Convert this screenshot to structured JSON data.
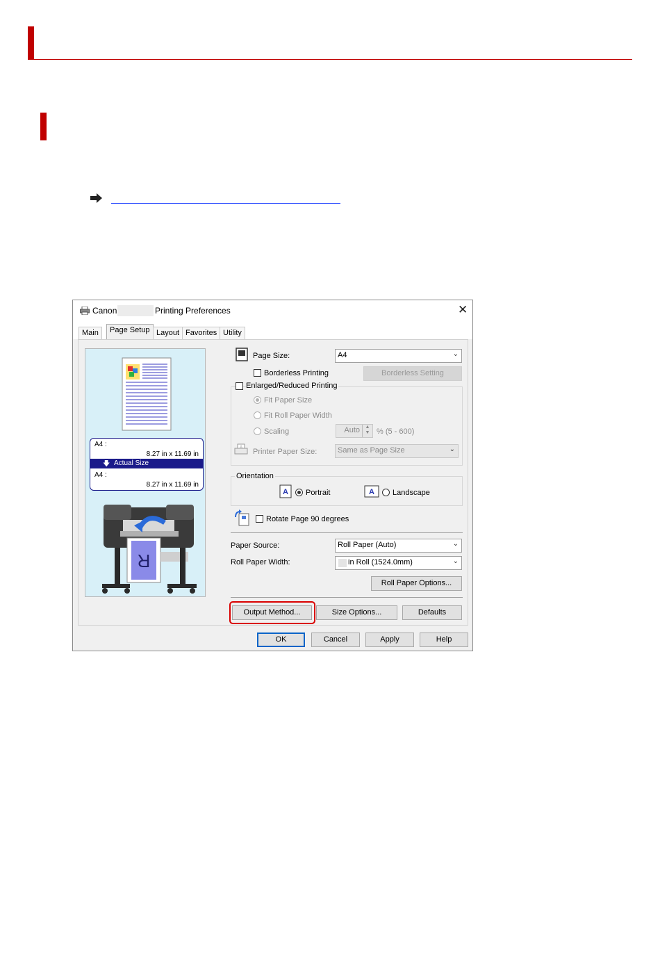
{
  "dialog": {
    "title_canon": "Canon",
    "title_suffix": "Printing Preferences",
    "tabs": [
      "Main",
      "Page Setup",
      "Layout",
      "Favorites",
      "Utility"
    ],
    "preview": {
      "input_size": "A4 :",
      "input_dims": "8.27 in x 11.69 in",
      "scaling_label": "Actual Size",
      "output_size": "A4 :",
      "output_dims": "8.27 in x 11.69 in"
    },
    "page_size_label": "Page Size:",
    "page_size_value": "A4",
    "borderless_label": "Borderless Printing",
    "borderless_setting_btn": "Borderless Setting",
    "enlarged_label": "Enlarged/Reduced Printing",
    "fit_paper_size": "Fit Paper Size",
    "fit_roll_width": "Fit Roll Paper Width",
    "scaling_label": "Scaling",
    "scaling_value": "Auto",
    "scaling_range": "% (5 - 600)",
    "printer_paper_size_label": "Printer Paper Size:",
    "printer_paper_size_value": "Same as Page Size",
    "orientation_label": "Orientation",
    "portrait_label": "Portrait",
    "landscape_label": "Landscape",
    "rotate_label": "Rotate Page 90 degrees",
    "paper_source_label": "Paper Source:",
    "paper_source_value": "Roll Paper (Auto)",
    "roll_width_label": "Roll Paper Width:",
    "roll_width_value": "in Roll (1524.0mm)",
    "roll_options_btn": "Roll Paper Options...",
    "output_method_btn": "Output Method...",
    "size_options_btn": "Size Options...",
    "defaults_btn": "Defaults",
    "ok_btn": "OK",
    "cancel_btn": "Cancel",
    "apply_btn": "Apply",
    "help_btn": "Help"
  },
  "colors": {
    "accent_red": "#c00000",
    "highlight_red": "#d90000",
    "link_blue": "#1a3cff",
    "preview_bg": "#d8f0f8",
    "selection_navy": "#1a1a8a"
  }
}
